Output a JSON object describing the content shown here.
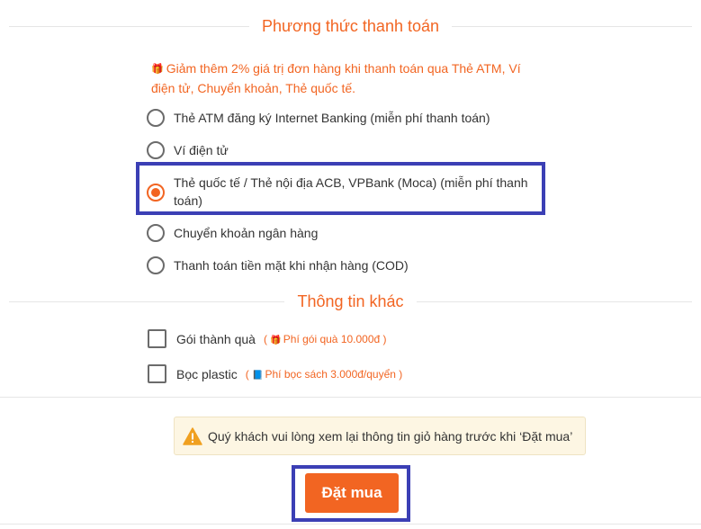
{
  "payment_section": {
    "title": "Phương thức thanh toán",
    "promo_icon": "gift-icon",
    "promo_text": "Giảm thêm 2% giá trị đơn hàng khi thanh toán qua Thẻ ATM, Ví điện tử, Chuyển khoản, Thẻ quốc tế.",
    "options": [
      {
        "label": "Thẻ ATM đăng ký Internet Banking (miễn phí thanh toán)",
        "selected": false
      },
      {
        "label": "Ví điện tử",
        "selected": false
      },
      {
        "label": "Thẻ quốc tế / Thẻ nội địa ACB, VPBank (Moca) (miễn phí thanh toán)",
        "selected": true
      },
      {
        "label": "Chuyển khoản ngân hàng",
        "selected": false
      },
      {
        "label": "Thanh toán tiền mặt khi nhận hàng (COD)",
        "selected": false
      }
    ]
  },
  "other_section": {
    "title": "Thông tin khác",
    "extras": [
      {
        "label": "Gói thành quà",
        "icon": "gift-icon",
        "fee_open": "(",
        "fee_text": "Phí gói quà 10.000đ",
        "fee_close": ")",
        "checked": false
      },
      {
        "label": "Bọc plastic",
        "icon": "book-icon",
        "fee_open": "(",
        "fee_text": "Phí bọc sách 3.000đ/quyển",
        "fee_close": ")",
        "checked": false
      }
    ]
  },
  "notice": {
    "icon": "warning-icon",
    "text": "Quý khách vui lòng xem lại thông tin giỏ hàng trước khi ‘Đặt mua’"
  },
  "order_button": {
    "label": "Đặt mua"
  },
  "colors": {
    "accent": "#f26522",
    "highlight": "#3b3fb5",
    "notice_bg": "#fdf6e3"
  }
}
